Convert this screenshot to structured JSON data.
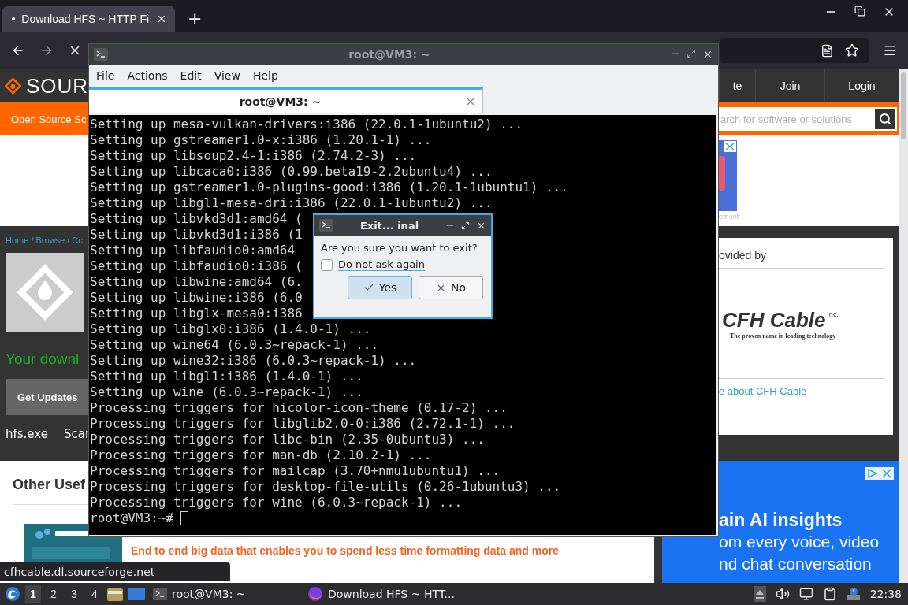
{
  "browser": {
    "tabs": [
      {
        "marker": "•",
        "title": "Download HFS ~ HTTP Fi",
        "selected": true
      }
    ],
    "new_tab": "+"
  },
  "site": {
    "logo_text": "SOUR",
    "nav": [
      "te",
      "Join",
      "Login"
    ],
    "category_link": "Open Source Sc",
    "search": {
      "placeholder": "arch for software or solutions"
    },
    "ad_label": "ement",
    "breadcrumb": "Home / Browse / Cc",
    "download_message": "Your downl",
    "get_updates": "Get Updates",
    "file_name": "hfs.exe",
    "scan_label": "Scar",
    "mirror": {
      "heading": "ovided by",
      "logo_name": "CFH Cable",
      "logo_suffix": "Inc.",
      "logo_tagline": "The proven name in leading technology",
      "link": "e about CFH Cable"
    },
    "other": {
      "heading": "Other Usef",
      "ad_text": "End to end big data that enables you to spend less time formatting data and more"
    },
    "ad": {
      "headline": "ain AI insights",
      "body": [
        "om every voice, video",
        "nd chat conversation"
      ]
    }
  },
  "terminal": {
    "title": "root@VM3: ~",
    "menu": [
      "File",
      "Actions",
      "Edit",
      "View",
      "Help"
    ],
    "tabs": [
      {
        "label": "root@VM3: ~",
        "selected": true
      }
    ],
    "lines": [
      "Setting up mesa-vulkan-drivers:i386 (22.0.1-1ubuntu2) ...",
      "Setting up gstreamer1.0-x:i386 (1.20.1-1) ...",
      "Setting up libsoup2.4-1:i386 (2.74.2-3) ...",
      "Setting up libcaca0:i386 (0.99.beta19-2.2ubuntu4) ...",
      "Setting up gstreamer1.0-plugins-good:i386 (1.20.1-1ubuntu1) ...",
      "Setting up libgl1-mesa-dri:i386 (22.0.1-1ubuntu2) ...",
      "Setting up libvkd3d1:amd64 (",
      "Setting up libvkd3d1:i386 (1",
      "Setting up libfaudio0:amd64",
      "Setting up libfaudio0:i386 (",
      "Setting up libwine:amd64 (6.",
      "Setting up libwine:i386 (6.0",
      "Setting up libglx-mesa0:i386",
      "Setting up libglx0:i386 (1.4.0-1) ...",
      "Setting up wine64 (6.0.3~repack-1) ...",
      "Setting up wine32:i386 (6.0.3~repack-1) ...",
      "Setting up libgl1:i386 (1.4.0-1) ...",
      "Setting up wine (6.0.3~repack-1) ...",
      "Processing triggers for hicolor-icon-theme (0.17-2) ...",
      "Processing triggers for libglib2.0-0:i386 (2.72.1-1) ...",
      "Processing triggers for libc-bin (2.35-0ubuntu3) ...",
      "Processing triggers for man-db (2.10.2-1) ...",
      "Processing triggers for mailcap (3.70+nmu1ubuntu1) ...",
      "Processing triggers for desktop-file-utils (0.26-1ubuntu3) ...",
      "Processing triggers for wine (6.0.3~repack-1) ..."
    ],
    "prompt": "root@VM3:~#"
  },
  "dialog": {
    "title": "Exit... inal",
    "message": "Are you sure you want to exit?",
    "checkbox": {
      "label": "Do not ask again",
      "checked": false
    },
    "buttons": [
      {
        "label": "Yes",
        "kind": "yes",
        "default": true
      },
      {
        "label": "No",
        "kind": "no",
        "default": false
      }
    ]
  },
  "status_tooltip": "cfhcable.dl.sourceforge.net",
  "taskbar": {
    "workspaces": [
      {
        "label": "1",
        "selected": true
      },
      {
        "label": "2",
        "selected": false
      },
      {
        "label": "3",
        "selected": false
      },
      {
        "label": "4",
        "selected": false
      }
    ],
    "tasks": [
      {
        "kind": "terminal",
        "label": "root@VM3: ~"
      },
      {
        "kind": "browser",
        "label": "Download HFS ~ HTT..."
      }
    ],
    "clock": "22:38"
  }
}
